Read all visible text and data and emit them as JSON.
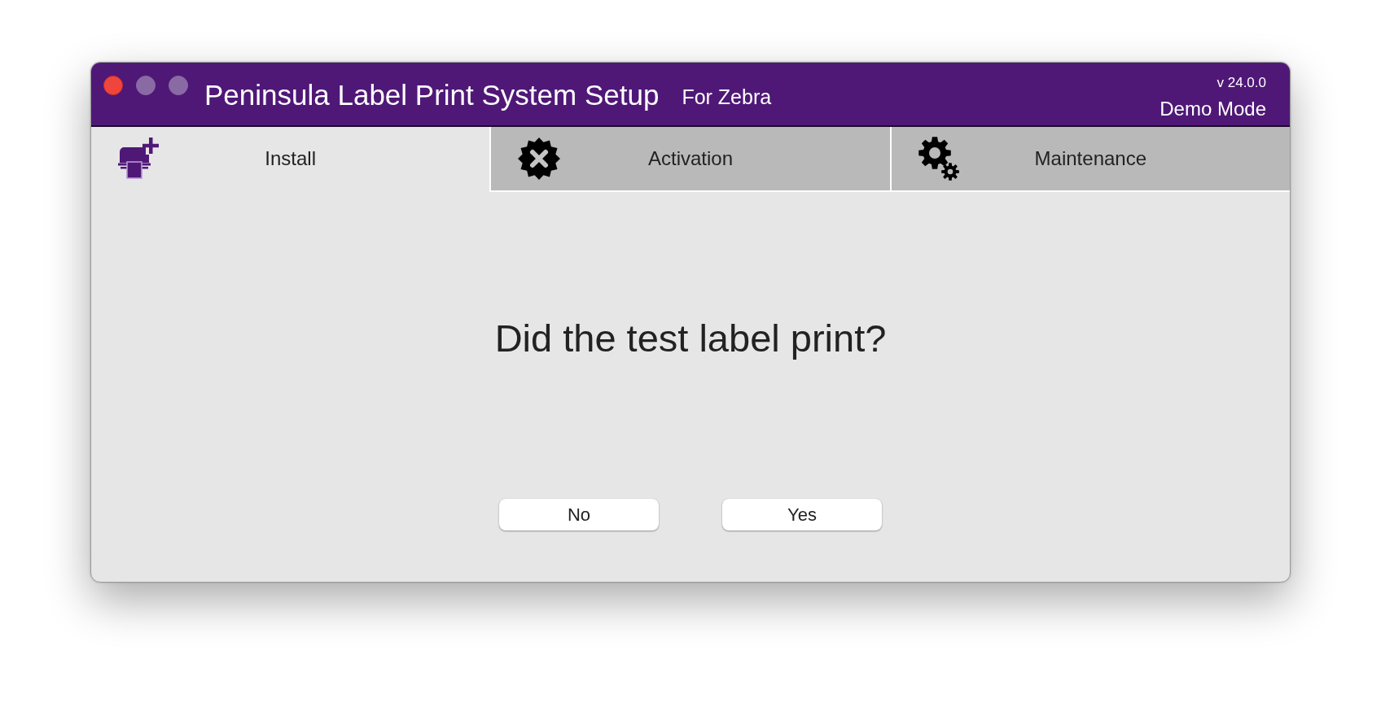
{
  "window": {
    "title": "Peninsula Label Print System Setup",
    "subtitle": "For Zebra",
    "version": "v 24.0.0",
    "mode": "Demo Mode",
    "controls": [
      {
        "kind": "close",
        "disabled": false
      },
      {
        "kind": "minimize",
        "disabled": true
      },
      {
        "kind": "zoom",
        "disabled": true
      }
    ]
  },
  "tabs": [
    {
      "label": "Install",
      "selected": true
    },
    {
      "label": "Activation",
      "selected": false
    },
    {
      "label": "Maintenance",
      "selected": false
    }
  ],
  "prompt": {
    "question": "Did the test label print?"
  },
  "buttons": [
    "No",
    "Yes"
  ]
}
